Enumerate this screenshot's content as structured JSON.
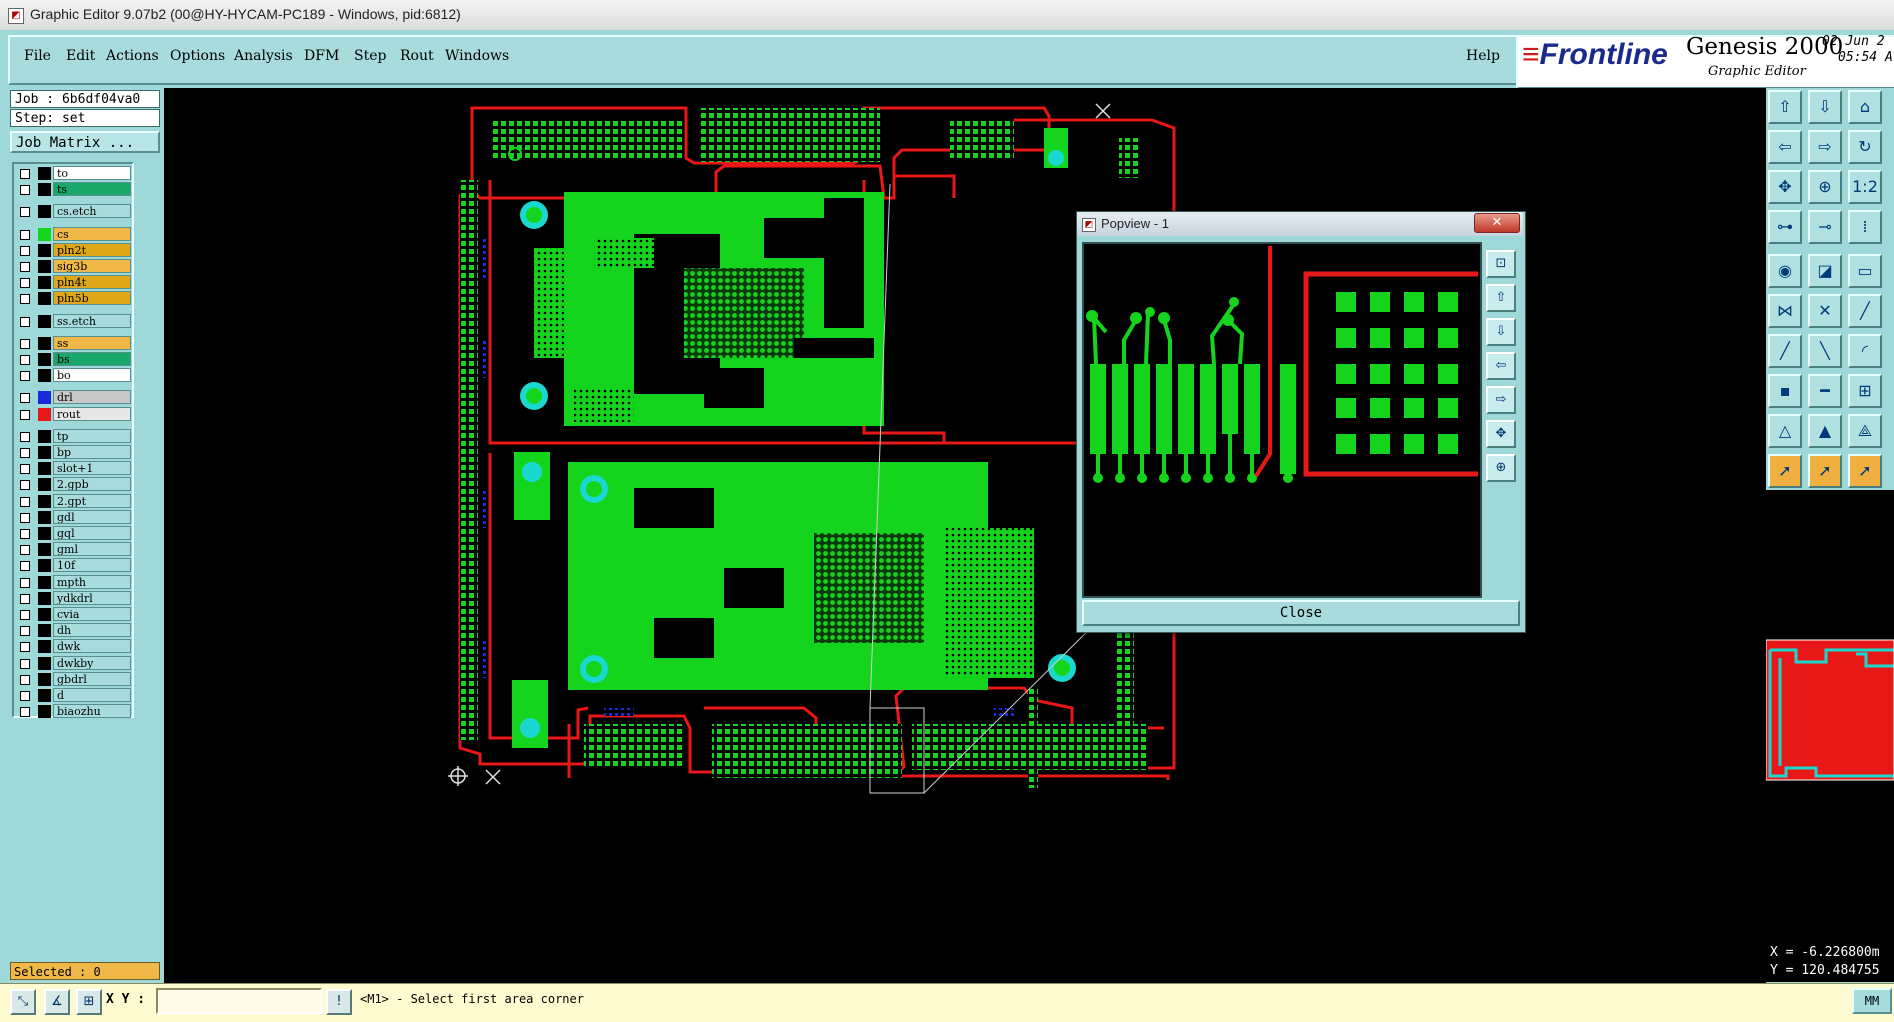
{
  "window": {
    "title": "Graphic Editor 9.07b2 (00@HY-HYCAM-PC189 - Windows, pid:6812)",
    "app_icon": "graphic-editor-icon"
  },
  "menu": {
    "items": [
      "File",
      "Edit",
      "Actions",
      "Options",
      "Analysis",
      "DFM",
      "Step",
      "Rout",
      "Windows"
    ],
    "help": "Help"
  },
  "brand": {
    "logo": "Frontline",
    "product": "Genesis 2000",
    "subtitle": "Graphic Editor",
    "date": "02 Jun 2",
    "time": "05:54 A"
  },
  "job": {
    "job_label": "Job : 6b6df04va0",
    "step_label": "Step: set",
    "matrix_button": "Job Matrix ..."
  },
  "layers": [
    {
      "name": "to",
      "swatch": "#000000",
      "fill": "#ffffff"
    },
    {
      "name": "ts",
      "swatch": "#000000",
      "fill": "#1aa86a"
    },
    {
      "name": "cs.etch",
      "swatch": "#000000",
      "fill": "#a8dcdc"
    },
    {
      "name": "cs",
      "swatch": "#14d41e",
      "fill": "#f0b848"
    },
    {
      "name": "pln2t",
      "swatch": "#000000",
      "fill": "#e0a818"
    },
    {
      "name": "sig3b",
      "swatch": "#000000",
      "fill": "#f0b848"
    },
    {
      "name": "pln4t",
      "swatch": "#000000",
      "fill": "#e0a818"
    },
    {
      "name": "pln5b",
      "swatch": "#000000",
      "fill": "#e0a818"
    },
    {
      "name": "ss.etch",
      "swatch": "#000000",
      "fill": "#a8dcdc"
    },
    {
      "name": "ss",
      "swatch": "#000000",
      "fill": "#f0b848"
    },
    {
      "name": "bs",
      "swatch": "#000000",
      "fill": "#1aa86a"
    },
    {
      "name": "bo",
      "swatch": "#000000",
      "fill": "#ffffff"
    },
    {
      "name": "drl",
      "swatch": "#1a2ad8",
      "fill": "#c8c8c8"
    },
    {
      "name": "rout",
      "swatch": "#e81818",
      "fill": "#e8e8e8"
    },
    {
      "name": "tp",
      "swatch": "#000000",
      "fill": "#a8dcdc"
    },
    {
      "name": "bp",
      "swatch": "#000000",
      "fill": "#a8dcdc"
    },
    {
      "name": "slot+1",
      "swatch": "#000000",
      "fill": "#a8dcdc"
    },
    {
      "name": "2.gpb",
      "swatch": "#000000",
      "fill": "#a8dcdc"
    },
    {
      "name": "2.gpt",
      "swatch": "#000000",
      "fill": "#a8dcdc"
    },
    {
      "name": "gdl",
      "swatch": "#000000",
      "fill": "#a8dcdc"
    },
    {
      "name": "gql",
      "swatch": "#000000",
      "fill": "#a8dcdc"
    },
    {
      "name": "gml",
      "swatch": "#000000",
      "fill": "#a8dcdc"
    },
    {
      "name": "10f",
      "swatch": "#000000",
      "fill": "#a8dcdc"
    },
    {
      "name": "mpth",
      "swatch": "#000000",
      "fill": "#a8dcdc"
    },
    {
      "name": "ydkdrl",
      "swatch": "#000000",
      "fill": "#a8dcdc"
    },
    {
      "name": "cvia",
      "swatch": "#000000",
      "fill": "#a8dcdc"
    },
    {
      "name": "dh",
      "swatch": "#000000",
      "fill": "#a8dcdc"
    },
    {
      "name": "dwk",
      "swatch": "#000000",
      "fill": "#a8dcdc"
    },
    {
      "name": "dwkby",
      "swatch": "#000000",
      "fill": "#a8dcdc"
    },
    {
      "name": "gbdrl",
      "swatch": "#000000",
      "fill": "#a8dcdc"
    },
    {
      "name": "d",
      "swatch": "#000000",
      "fill": "#a8dcdc"
    },
    {
      "name": "biaozhu",
      "swatch": "#000000",
      "fill": "#a8dcdc"
    }
  ],
  "selected_label": "Selected : 0",
  "popview": {
    "title": "Popview - 1",
    "close_button": "Close",
    "close_x": "✕"
  },
  "coords": {
    "x": "X = -6.226800m",
    "y": "Y = 120.484755"
  },
  "bottom": {
    "xy_label": "X Y :",
    "xy_value": "",
    "info_icon": "!",
    "status": "<M1> - Select first area corner",
    "units": "MM"
  },
  "colors": {
    "pcb_green": "#14d41e",
    "pcb_red": "#e81818",
    "pcb_cyan": "#19d8d0",
    "pcb_blue": "#1a2ad8",
    "panel": "#9fd8d8",
    "canvas": "#000000"
  }
}
